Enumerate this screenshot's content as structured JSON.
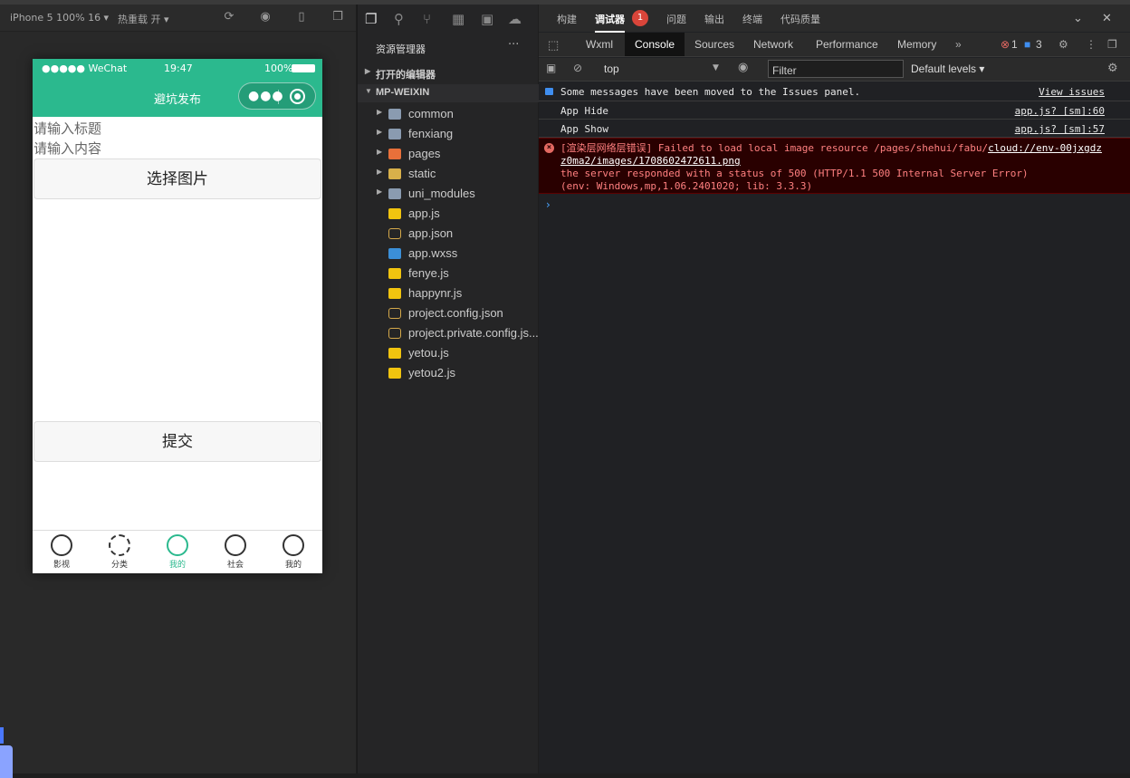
{
  "simulator": {
    "device": "iPhone 5 100% 16 ▾",
    "hotreload": "热重载 开 ▾",
    "status": {
      "carrier": "●●●●● WeChat",
      "time": "19:47",
      "battery": "100%"
    },
    "nav_title": "避坑发布",
    "title_placeholder": "请输入标题",
    "content_placeholder": "请输入内容",
    "choose_image": "选择图片",
    "submit": "提交",
    "tabs": [
      "影视",
      "分类",
      "我的",
      "社会",
      "我的"
    ],
    "active_tab": 2,
    "accent": "#2bb98e"
  },
  "explorer": {
    "title": "资源管理器",
    "more": "···",
    "open_editors": "打开的编辑器",
    "project": "MP-WEIXIN",
    "items": [
      {
        "name": "common",
        "type": "folder"
      },
      {
        "name": "fenxiang",
        "type": "folder"
      },
      {
        "name": "pages",
        "type": "pages"
      },
      {
        "name": "static",
        "type": "static"
      },
      {
        "name": "uni_modules",
        "type": "folder"
      },
      {
        "name": "app.js",
        "type": "js"
      },
      {
        "name": "app.json",
        "type": "json"
      },
      {
        "name": "app.wxss",
        "type": "wxss"
      },
      {
        "name": "fenye.js",
        "type": "js"
      },
      {
        "name": "happynr.js",
        "type": "js"
      },
      {
        "name": "project.config.json",
        "type": "json"
      },
      {
        "name": "project.private.config.js...",
        "type": "json"
      },
      {
        "name": "yetou.js",
        "type": "js"
      },
      {
        "name": "yetou2.js",
        "type": "js"
      }
    ]
  },
  "devtools": {
    "top_tabs": [
      "构建",
      "调试器",
      "问题",
      "输出",
      "终端",
      "代码质量"
    ],
    "debugger_badge": "1",
    "panel_tabs": [
      "Wxml",
      "Console",
      "Sources",
      "Network",
      "Performance",
      "Memory"
    ],
    "error_count": "1",
    "info_count": "3",
    "context": "top",
    "filter_placeholder": "Filter",
    "levels": "Default levels ▾",
    "messages": [
      {
        "text": "Some messages have been moved to the Issues panel.",
        "link": "View issues"
      },
      {
        "text": "App Hide",
        "link": "app.js? [sm]:60"
      },
      {
        "text": "App Show",
        "link": "app.js? [sm]:57"
      }
    ],
    "error": {
      "prefix": "[渲染层网络层错误] Failed to load local image resource /pages/shehui/fabu/",
      "url1": "cloud://env-00jxgdz",
      "url2": "z0ma2/images/1708602472611.png",
      "line3": " the server responded with a status of 500 (HTTP/1.1 500 Internal Server Error)",
      "line4": "(env: Windows,mp,1.06.2401020; lib: 3.3.3)"
    }
  }
}
